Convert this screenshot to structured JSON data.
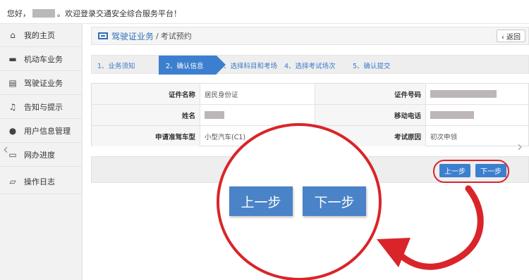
{
  "welcome": {
    "prefix": "您好，",
    "suffix": "。欢迎登录交通安全综合服务平台！"
  },
  "sidebar": {
    "items": [
      {
        "label": "我的主页",
        "icon": "home-icon",
        "glyph": "⌂"
      },
      {
        "label": "机动车业务",
        "icon": "truck-icon",
        "glyph": "▬"
      },
      {
        "label": "驾驶证业务",
        "icon": "license-card-icon",
        "glyph": "▤"
      },
      {
        "label": "告知与提示",
        "icon": "bell-icon",
        "glyph": "♫"
      },
      {
        "label": "用户信息管理",
        "icon": "user-icon",
        "glyph": "●"
      },
      {
        "label": "网办进度",
        "icon": "progress-icon",
        "glyph": "▭"
      },
      {
        "label": "操作日志",
        "icon": "log-icon",
        "glyph": "▱"
      }
    ]
  },
  "header": {
    "title": "驾驶证业务",
    "separator": "/",
    "subtitle": "考试预约",
    "back_label": "‹ 返回"
  },
  "steps": [
    {
      "label": "1、业务须知"
    },
    {
      "label": "2、确认信息"
    },
    {
      "label": "3、选择科目和考场"
    },
    {
      "label": "4、选择考试场次"
    },
    {
      "label": "5、确认提交"
    }
  ],
  "info": {
    "rows": [
      {
        "label1": "证件名称",
        "value1": "居民身份证",
        "label2": "证件号码",
        "value2": ""
      },
      {
        "label1": "姓名",
        "value1": "",
        "label2": "移动电话",
        "value2": ""
      },
      {
        "label1": "申请准驾车型",
        "value1": "小型汽车(C1)",
        "label2": "考试原因",
        "value2": "初次申领"
      }
    ]
  },
  "buttons": {
    "prev": "上一步",
    "next": "下一步"
  },
  "colors": {
    "accent": "#3d7fcf",
    "highlight": "#d9252a"
  }
}
